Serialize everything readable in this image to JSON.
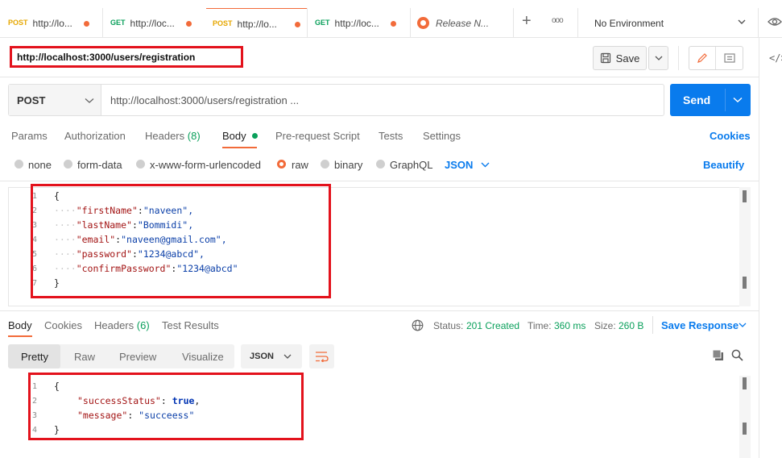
{
  "tabs": [
    {
      "method": "POST",
      "url": "http://lo..."
    },
    {
      "method": "GET",
      "url": "http://loc..."
    },
    {
      "method": "POST",
      "url": "http://lo..."
    },
    {
      "method": "GET",
      "url": "http://loc..."
    },
    {
      "label": "Release N..."
    }
  ],
  "environment": "No Environment",
  "request_name": "http://localhost:3000/users/registration",
  "save_label": "Save",
  "method": "POST",
  "url": "http://localhost:3000/users/registration ...",
  "send_label": "Send",
  "request_tabs": {
    "params": "Params",
    "authorization": "Authorization",
    "headers": "Headers",
    "headers_count": "(8)",
    "body": "Body",
    "prerequest": "Pre-request Script",
    "tests": "Tests",
    "settings": "Settings",
    "cookies": "Cookies"
  },
  "body_types": {
    "none": "none",
    "form_data": "form-data",
    "urlencoded": "x-www-form-urlencoded",
    "raw": "raw",
    "binary": "binary",
    "graphql": "GraphQL",
    "language": "JSON",
    "beautify": "Beautify"
  },
  "request_body": {
    "line_numbers": [
      "1",
      "2",
      "3",
      "4",
      "5",
      "6",
      "7"
    ],
    "open_brace": "{",
    "close_brace": "}",
    "fields": [
      {
        "key": "\"firstName\"",
        "value": "\"naveen\","
      },
      {
        "key": "\"lastName\"",
        "value": "\"Bommidi\","
      },
      {
        "key": "\"email\"",
        "value": "\"naveen@gmail.com\","
      },
      {
        "key": "\"password\"",
        "value": "\"1234@abcd\","
      },
      {
        "key": "\"confirmPassword\"",
        "value": "\"1234@abcd\""
      }
    ]
  },
  "response_tabs": {
    "body": "Body",
    "cookies": "Cookies",
    "headers": "Headers",
    "headers_count": "(6)",
    "test_results": "Test Results"
  },
  "status": {
    "status_label": "Status:",
    "status_value": "201 Created",
    "time_label": "Time:",
    "time_value": "360 ms",
    "size_label": "Size:",
    "size_value": "260 B",
    "save_response": "Save Response"
  },
  "view_modes": {
    "pretty": "Pretty",
    "raw": "Raw",
    "preview": "Preview",
    "visualize": "Visualize",
    "format": "JSON"
  },
  "response_body": {
    "line_numbers": [
      "1",
      "2",
      "3",
      "4"
    ],
    "open_brace": "{",
    "close_brace": "}",
    "line2_key": "\"successStatus\"",
    "line2_value": "true",
    "line3_key": "\"message\"",
    "line3_value": "\"succeess\""
  },
  "colors": {
    "accent": "#f26b3a",
    "send": "#097bed",
    "highlight_box": "#e3121c",
    "status_ok": "#0aa05b"
  }
}
